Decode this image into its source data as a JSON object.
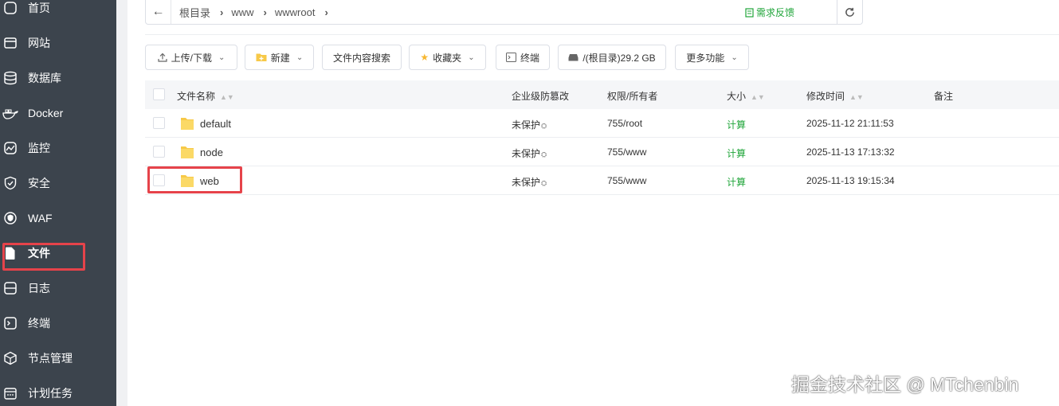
{
  "sidebar": {
    "items": [
      {
        "label": "首页",
        "icon": "home-icon"
      },
      {
        "label": "网站",
        "icon": "website-icon"
      },
      {
        "label": "数据库",
        "icon": "database-icon"
      },
      {
        "label": "Docker",
        "icon": "docker-icon"
      },
      {
        "label": "监控",
        "icon": "monitor-icon"
      },
      {
        "label": "安全",
        "icon": "shield-icon"
      },
      {
        "label": "WAF",
        "icon": "waf-icon"
      },
      {
        "label": "文件",
        "icon": "file-icon",
        "active": true
      },
      {
        "label": "日志",
        "icon": "log-icon"
      },
      {
        "label": "终端",
        "icon": "terminal-icon"
      },
      {
        "label": "节点管理",
        "icon": "node-icon"
      },
      {
        "label": "计划任务",
        "icon": "calendar-icon"
      }
    ]
  },
  "pathbar": {
    "crumbs": [
      "根目录",
      "www",
      "wwwroot"
    ],
    "feedback": "需求反馈"
  },
  "toolbar": {
    "upload": "上传/下载",
    "new": "新建",
    "search": "文件内容搜索",
    "favorites": "收藏夹",
    "terminal": "终端",
    "disk": "/(根目录)29.2 GB",
    "more": "更多功能"
  },
  "table": {
    "headers": {
      "name": "文件名称",
      "protect": "企业级防篡改",
      "perm": "权限/所有者",
      "size": "大小",
      "mtime": "修改时间",
      "note": "备注"
    },
    "rows": [
      {
        "name": "default",
        "protect": "未保护",
        "perm": "755/root",
        "size": "计算",
        "mtime": "2025-11-12 21:11:53"
      },
      {
        "name": "node",
        "protect": "未保护",
        "perm": "755/www",
        "size": "计算",
        "mtime": "2025-11-13 17:13:32"
      },
      {
        "name": "web",
        "protect": "未保护",
        "perm": "755/www",
        "size": "计算",
        "mtime": "2025-11-13 19:15:34"
      }
    ]
  },
  "watermark": "掘金技术社区 @ MTchenbin",
  "colors": {
    "sidebar": "#3c444d",
    "accent": "#20a53a",
    "highlight": "#e6434a",
    "folder": "#f7c948"
  }
}
